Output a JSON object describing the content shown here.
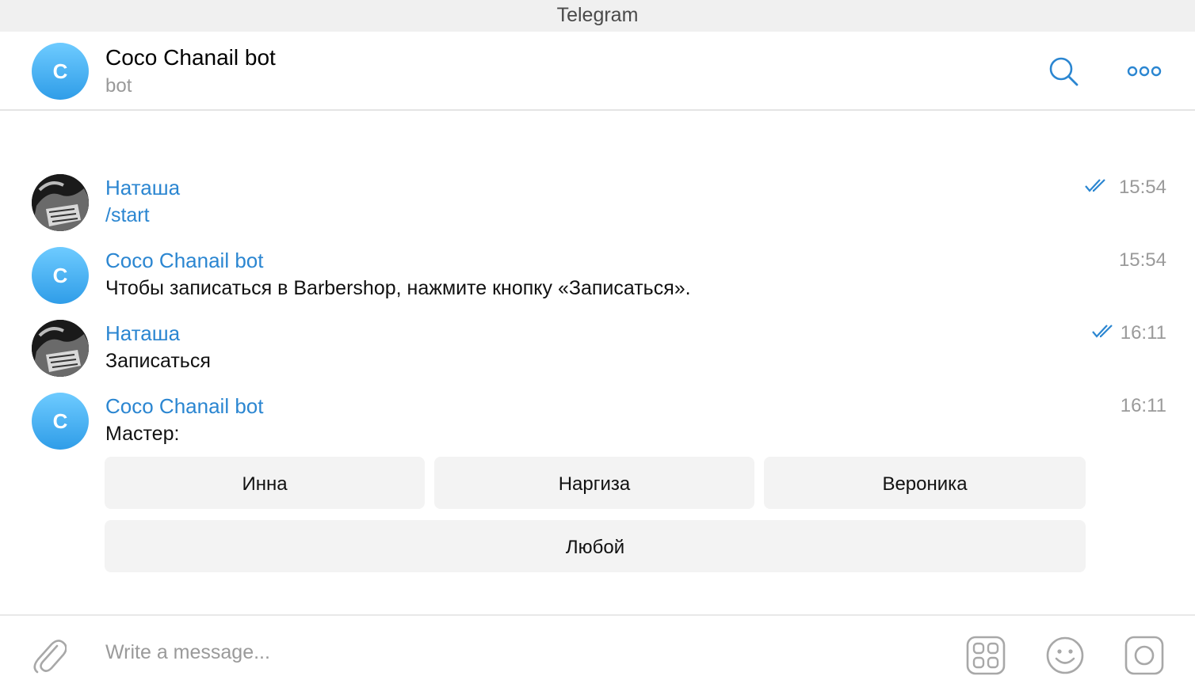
{
  "window": {
    "title": "Telegram"
  },
  "header": {
    "avatar_letter": "C",
    "chat_name": "Coco Chanail bot",
    "chat_status": "bot",
    "icons": [
      "search-icon",
      "more-icon"
    ]
  },
  "messages": [
    {
      "sender": "Наташа",
      "text": "/start",
      "time": "15:54",
      "outgoing": true,
      "read": true
    },
    {
      "sender": "Coco Chanail bot",
      "text": "Чтобы записаться в Barbershop, нажмите кнопку «Записаться».",
      "time": "15:54",
      "outgoing": false
    },
    {
      "sender": "Наташа",
      "text": "Записаться",
      "time": "16:11",
      "outgoing": true,
      "read": true
    },
    {
      "sender": "Coco Chanail bot",
      "text": "Мастер:",
      "time": "16:11",
      "outgoing": false
    }
  ],
  "keyboard": {
    "rows": [
      [
        "Инна",
        "Наргиза",
        "Вероника"
      ],
      [
        "Любой"
      ]
    ]
  },
  "composer": {
    "placeholder": "Write a message...",
    "icons": [
      "attach-icon",
      "bot-commands-icon",
      "emoji-icon",
      "camera-icon"
    ]
  },
  "colors": {
    "accent": "#2b86d1",
    "avatar_gradient_top": "#6ecbff",
    "avatar_gradient_bottom": "#2f9de8",
    "button_bg": "#f3f3f3",
    "time_gray": "#9a9a9a"
  }
}
